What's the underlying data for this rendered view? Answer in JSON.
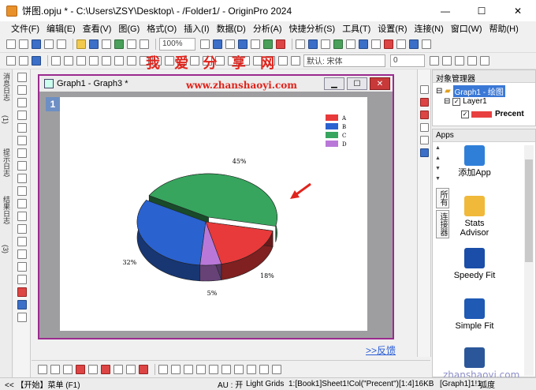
{
  "window": {
    "title": "饼图.opju * - C:\\Users\\ZSY\\Desktop\\ - /Folder1/ - OriginPro 2024",
    "minimize": "—",
    "maximize": "☐",
    "close": "✕"
  },
  "menu": [
    "文件(F)",
    "编辑(E)",
    "查看(V)",
    "图(G)",
    "格式(O)",
    "插入(I)",
    "数据(D)",
    "分析(A)",
    "快捷分析(S)",
    "工具(T)",
    "设置(R)",
    "连接(N)",
    "窗口(W)",
    "帮助(H)"
  ],
  "toolbar": {
    "zoom": "100%",
    "font": "默认: 宋体",
    "size": "0"
  },
  "watermark": {
    "top": "我 爱 分 享 网",
    "site": "www.zhanshaoyi.com",
    "bottom": "zhanshaoyi.com"
  },
  "left_tabs": [
    "消息日志",
    "提示日志",
    "(1)",
    "结果日志",
    "(3)"
  ],
  "graph_window": {
    "title": "Graph1 - Graph3 *",
    "layer_label": "1",
    "min": "▁",
    "max": "☐",
    "close": "✕"
  },
  "chart_data": {
    "type": "pie",
    "categories": [
      "A",
      "B",
      "C",
      "D"
    ],
    "values": [
      18,
      32,
      45,
      5
    ],
    "labels": [
      "18%",
      "32%",
      "45%",
      "5%"
    ],
    "colors": [
      "#e83a3a",
      "#2a62d0",
      "#37a55e",
      "#b978d8"
    ],
    "legend_position": "top-right"
  },
  "feedback": ">>反馈",
  "object_manager": {
    "title": "对象管理器",
    "graph": "Graph1 - 绘图",
    "layer": "Layer1",
    "plot": "Precent"
  },
  "apps": {
    "title": "Apps",
    "tabs": [
      "所有",
      "连接器"
    ],
    "items": [
      {
        "name": "添加App",
        "icon": "add-app-icon",
        "color": "#2f7fd8"
      },
      {
        "name": "Stats Advisor",
        "icon": "wand-icon",
        "color": "#f0b93a"
      },
      {
        "name": "Speedy Fit",
        "icon": "speedy-fit-icon",
        "color": "#1a4ea8"
      },
      {
        "name": "Simple Fit",
        "icon": "simple-fit-icon",
        "color": "#1f5ab5"
      }
    ]
  },
  "status": {
    "start": "<< 【开始】菜单 (F1)",
    "au": "AU : 开",
    "grid": "Light Grids",
    "ref": "1:[Book1]Sheet1!Col(\"Precent\")[1:4]",
    "size": "16KB",
    "graph": "[Graph1]1!1",
    "angle": "弧度"
  }
}
